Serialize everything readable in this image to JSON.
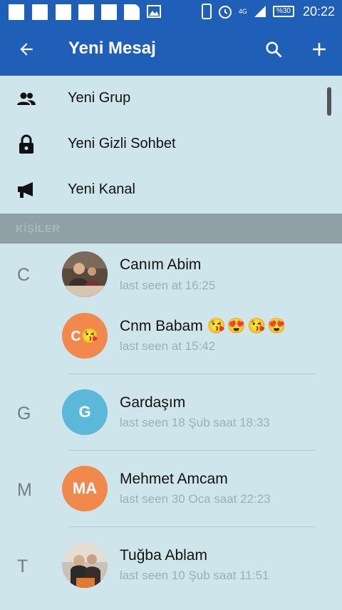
{
  "status_bar": {
    "clock": "20:22",
    "battery": "%30",
    "network": "4G",
    "icons": [
      "notification-icon",
      "notification-icon",
      "notification-icon",
      "notification-icon",
      "notification-icon",
      "notification-icon",
      "image-icon",
      "phone-icon",
      "alarm-icon",
      "signal-icon",
      "battery-icon"
    ]
  },
  "app_bar": {
    "title": "Yeni Mesaj",
    "back_icon": "back-arrow-icon",
    "search_icon": "search-icon",
    "add_icon": "plus-icon"
  },
  "menu": [
    {
      "icon": "group-icon",
      "label": "Yeni Grup"
    },
    {
      "icon": "lock-icon",
      "label": "Yeni Gizli Sohbet"
    },
    {
      "icon": "megaphone-icon",
      "label": "Yeni Kanal"
    }
  ],
  "section_header": "KİŞİLER",
  "contacts": [
    {
      "letter": "C",
      "name": "Canım Abim",
      "status": "last seen at 16:25",
      "avatar": "photo"
    },
    {
      "letter": "",
      "name": "Cnm Babam",
      "emojis": "😘😍😘😍",
      "status": "last seen at 15:42",
      "initials": "C😘",
      "avatar_color": "#f0894b"
    },
    {
      "letter": "G",
      "name": "Gardaşım",
      "status": "last seen 18 Şub saat 18:33",
      "initials": "G",
      "avatar_color": "#5bb8d8"
    },
    {
      "letter": "M",
      "name": "Mehmet Amcam",
      "status": "last seen 30 Oca saat 22:23",
      "initials": "MA",
      "avatar_color": "#f0894b"
    },
    {
      "letter": "T",
      "name": "Tuğba Ablam",
      "status": "last seen 10 Şub saat 11:51",
      "avatar": "photo"
    }
  ],
  "colors": {
    "app_bar": "#1f5fb8",
    "background": "#cfe5ec",
    "section_header_bg": "#8fa1a6",
    "orange_avatar": "#f0894b",
    "blue_avatar": "#5bb8d8"
  }
}
